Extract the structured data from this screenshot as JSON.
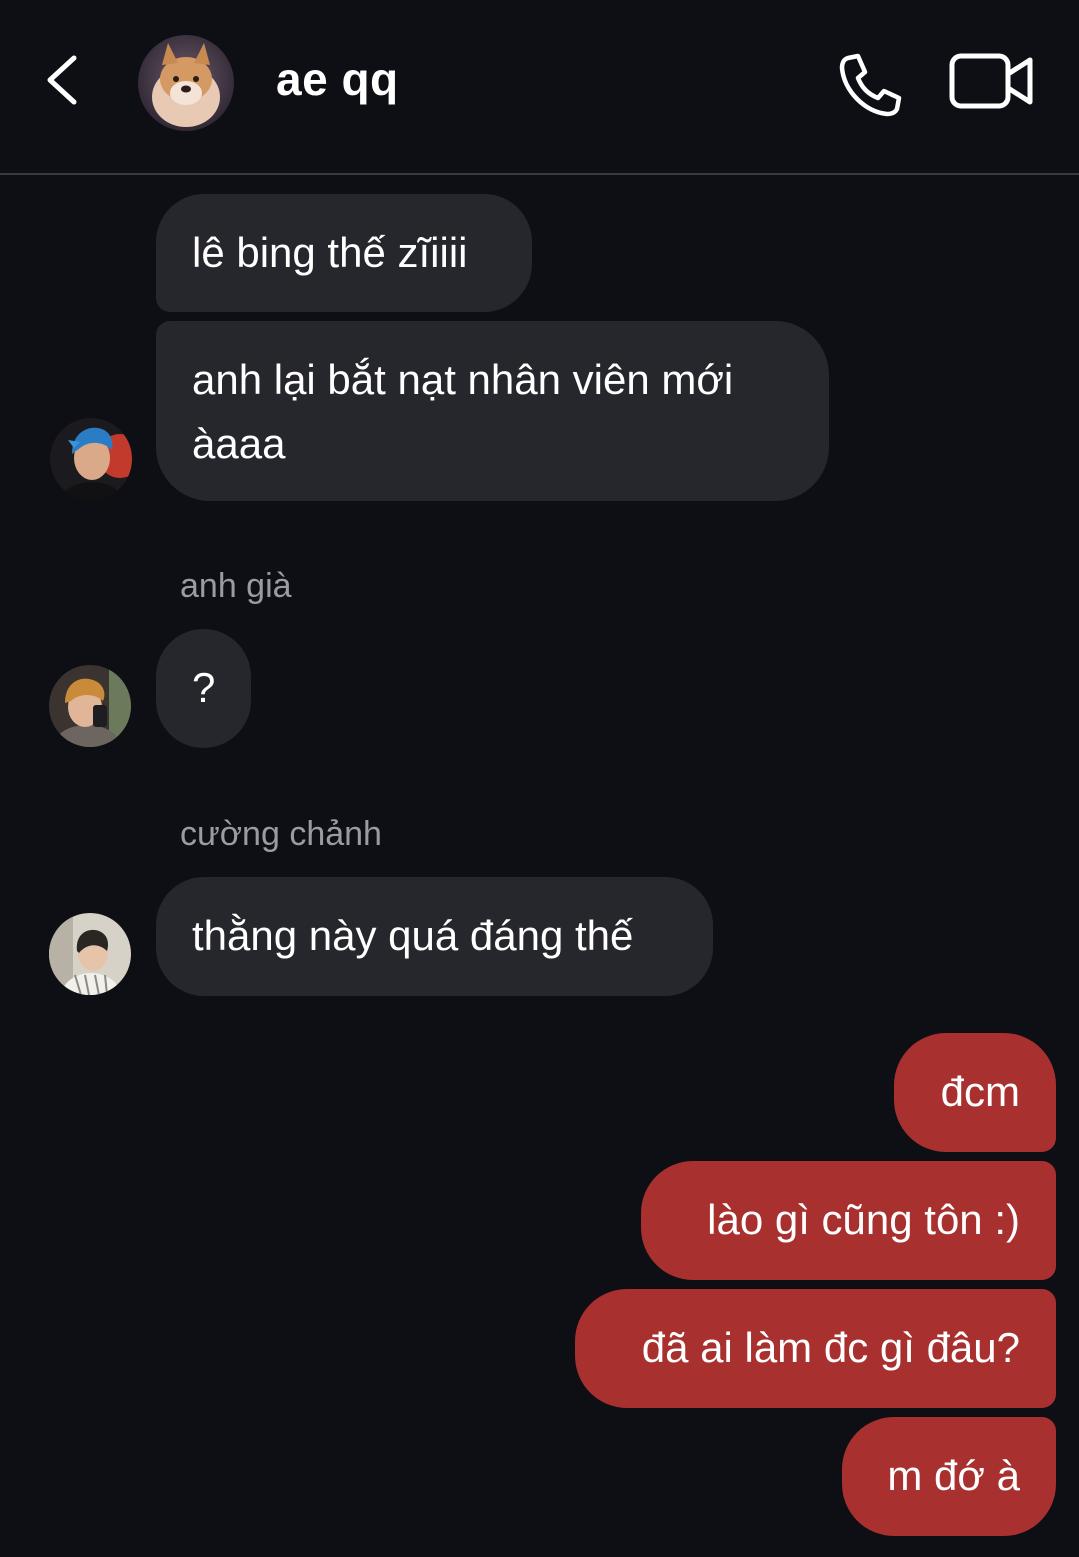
{
  "header": {
    "title": "ae qq",
    "back_icon": "chevron-left-icon",
    "call_icon": "phone-icon",
    "video_icon": "video-camera-icon"
  },
  "messages_in": [
    {
      "text": "lê bing thế zĩiiii"
    },
    {
      "text_line1": "anh lại bắt nạt nhân viên mới",
      "text_line2": "àaaa"
    },
    {
      "sender": "anh già",
      "text": "?"
    },
    {
      "sender": "cường chảnh",
      "text": "thằng này quá đáng thế"
    }
  ],
  "messages_out": [
    {
      "text": "đcm"
    },
    {
      "text": "lào gì cũng tôn :)"
    },
    {
      "text": "đã ai làm đc gì đâu?"
    },
    {
      "text": "m đớ à"
    }
  ],
  "colors": {
    "background": "#0e0f14",
    "incoming_bubble": "#26272c",
    "outgoing_bubble": "#a8302f",
    "sender_name": "#9a9ba3",
    "divider": "#3a3b40"
  }
}
